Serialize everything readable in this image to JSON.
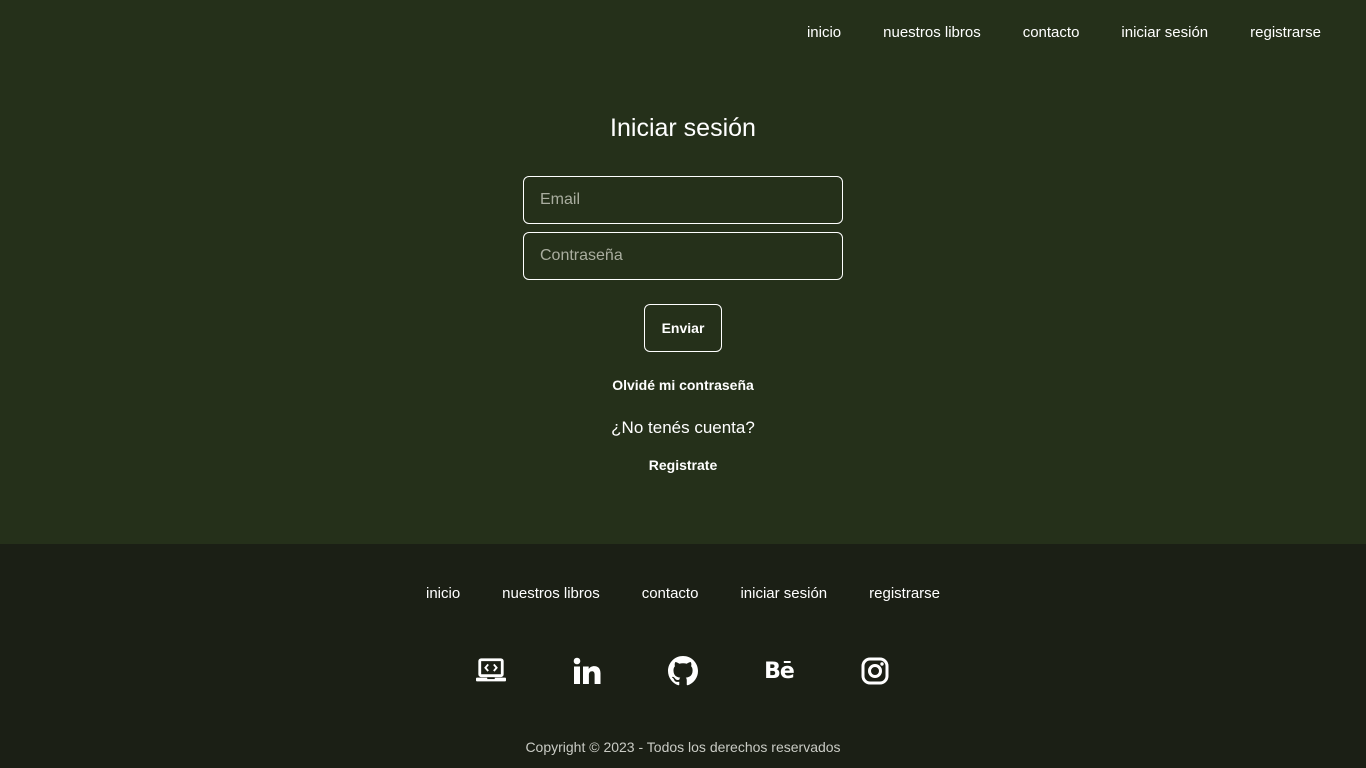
{
  "nav": {
    "items": [
      {
        "label": "inicio"
      },
      {
        "label": "nuestros libros"
      },
      {
        "label": "contacto"
      },
      {
        "label": "iniciar sesión"
      },
      {
        "label": "registrarse"
      }
    ]
  },
  "login": {
    "title": "Iniciar sesión",
    "email_placeholder": "Email",
    "email_value": "",
    "password_placeholder": "Contraseña",
    "password_value": "",
    "submit_label": "Enviar",
    "forgot_label": "Olvidé mi contraseña",
    "no_account_text": "¿No tenés cuenta?",
    "register_label": "Registrate"
  },
  "footer": {
    "nav": [
      {
        "label": "inicio"
      },
      {
        "label": "nuestros libros"
      },
      {
        "label": "contacto"
      },
      {
        "label": "iniciar sesión"
      },
      {
        "label": "registrarse"
      }
    ],
    "social_icons": [
      "portfolio-laptop-icon",
      "linkedin-icon",
      "github-icon",
      "behance-icon",
      "instagram-icon"
    ],
    "behance_glyph": "Bē",
    "copyright": "Copyright © 2023 - Todos los derechos reservados"
  },
  "colors": {
    "main_background": "#25301a",
    "footer_background": "#1b1f15",
    "text": "#ffffff",
    "placeholder": "#a9ad9f"
  }
}
